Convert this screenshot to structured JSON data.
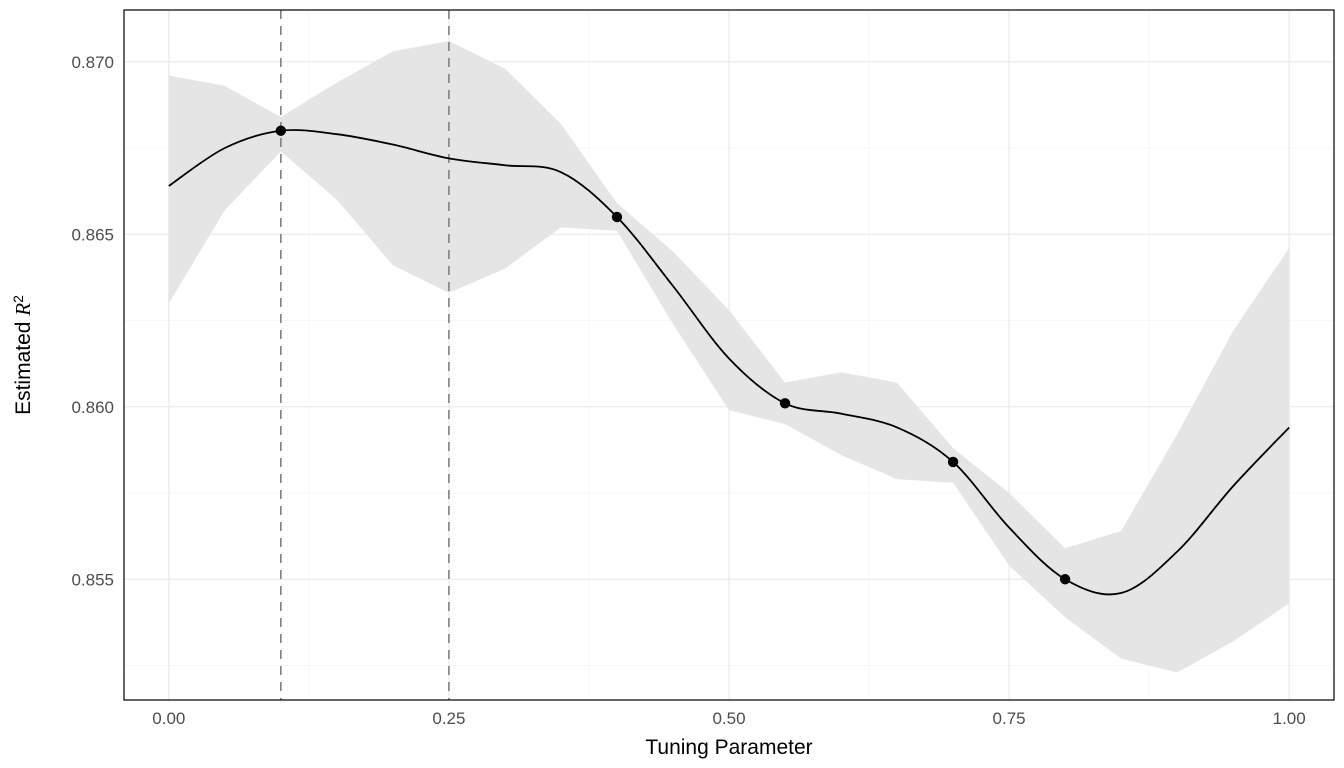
{
  "chart_data": {
    "type": "line",
    "xlabel": "Tuning Parameter",
    "ylabel_prefix": "Estimated ",
    "ylabel_math": "R",
    "ylabel_sup": "2",
    "xlim": [
      -0.04,
      1.04
    ],
    "ylim": [
      0.8515,
      0.8715
    ],
    "x_ticks": [
      0.0,
      0.25,
      0.5,
      0.75,
      1.0
    ],
    "x_tick_labels": [
      "0.00",
      "0.25",
      "0.50",
      "0.75",
      "1.00"
    ],
    "x_minor_ticks": [
      0.125,
      0.375,
      0.625,
      0.875
    ],
    "y_ticks": [
      0.855,
      0.86,
      0.865,
      0.87
    ],
    "y_tick_labels": [
      "0.855",
      "0.860",
      "0.865",
      "0.870"
    ],
    "y_minor_ticks": [
      0.8525,
      0.8575,
      0.8625,
      0.8675
    ],
    "vlines": [
      0.1,
      0.25
    ],
    "points": [
      {
        "x": 0.1,
        "y": 0.868
      },
      {
        "x": 0.4,
        "y": 0.8655
      },
      {
        "x": 0.55,
        "y": 0.8601
      },
      {
        "x": 0.7,
        "y": 0.8584
      },
      {
        "x": 0.8,
        "y": 0.855
      }
    ],
    "curve": [
      {
        "x": 0.0,
        "y": 0.8664
      },
      {
        "x": 0.05,
        "y": 0.8675
      },
      {
        "x": 0.1,
        "y": 0.868
      },
      {
        "x": 0.15,
        "y": 0.8679
      },
      {
        "x": 0.2,
        "y": 0.8676
      },
      {
        "x": 0.25,
        "y": 0.8672
      },
      {
        "x": 0.3,
        "y": 0.867
      },
      {
        "x": 0.35,
        "y": 0.8668
      },
      {
        "x": 0.4,
        "y": 0.8655
      },
      {
        "x": 0.45,
        "y": 0.8635
      },
      {
        "x": 0.5,
        "y": 0.8614
      },
      {
        "x": 0.55,
        "y": 0.8601
      },
      {
        "x": 0.6,
        "y": 0.8598
      },
      {
        "x": 0.65,
        "y": 0.8594
      },
      {
        "x": 0.7,
        "y": 0.8584
      },
      {
        "x": 0.75,
        "y": 0.8565
      },
      {
        "x": 0.8,
        "y": 0.855
      },
      {
        "x": 0.85,
        "y": 0.8546
      },
      {
        "x": 0.9,
        "y": 0.8558
      },
      {
        "x": 0.95,
        "y": 0.8577
      },
      {
        "x": 1.0,
        "y": 0.8594
      }
    ],
    "ribbon": [
      {
        "x": 0.0,
        "lo": 0.863,
        "hi": 0.8696
      },
      {
        "x": 0.05,
        "lo": 0.8657,
        "hi": 0.8693
      },
      {
        "x": 0.1,
        "lo": 0.8674,
        "hi": 0.8684
      },
      {
        "x": 0.15,
        "lo": 0.866,
        "hi": 0.8694
      },
      {
        "x": 0.2,
        "lo": 0.8641,
        "hi": 0.8703
      },
      {
        "x": 0.25,
        "lo": 0.8633,
        "hi": 0.8706
      },
      {
        "x": 0.3,
        "lo": 0.864,
        "hi": 0.8698
      },
      {
        "x": 0.35,
        "lo": 0.8652,
        "hi": 0.8682
      },
      {
        "x": 0.4,
        "lo": 0.8651,
        "hi": 0.8659
      },
      {
        "x": 0.45,
        "lo": 0.8624,
        "hi": 0.8645
      },
      {
        "x": 0.5,
        "lo": 0.8599,
        "hi": 0.8628
      },
      {
        "x": 0.55,
        "lo": 0.8595,
        "hi": 0.8607
      },
      {
        "x": 0.6,
        "lo": 0.8586,
        "hi": 0.861
      },
      {
        "x": 0.65,
        "lo": 0.8579,
        "hi": 0.8607
      },
      {
        "x": 0.7,
        "lo": 0.8578,
        "hi": 0.8588
      },
      {
        "x": 0.75,
        "lo": 0.8554,
        "hi": 0.8575
      },
      {
        "x": 0.8,
        "lo": 0.8539,
        "hi": 0.8559
      },
      {
        "x": 0.85,
        "lo": 0.8527,
        "hi": 0.8564
      },
      {
        "x": 0.9,
        "lo": 0.8523,
        "hi": 0.8592
      },
      {
        "x": 0.95,
        "lo": 0.8532,
        "hi": 0.8622
      },
      {
        "x": 1.0,
        "lo": 0.8543,
        "hi": 0.8646
      }
    ]
  }
}
